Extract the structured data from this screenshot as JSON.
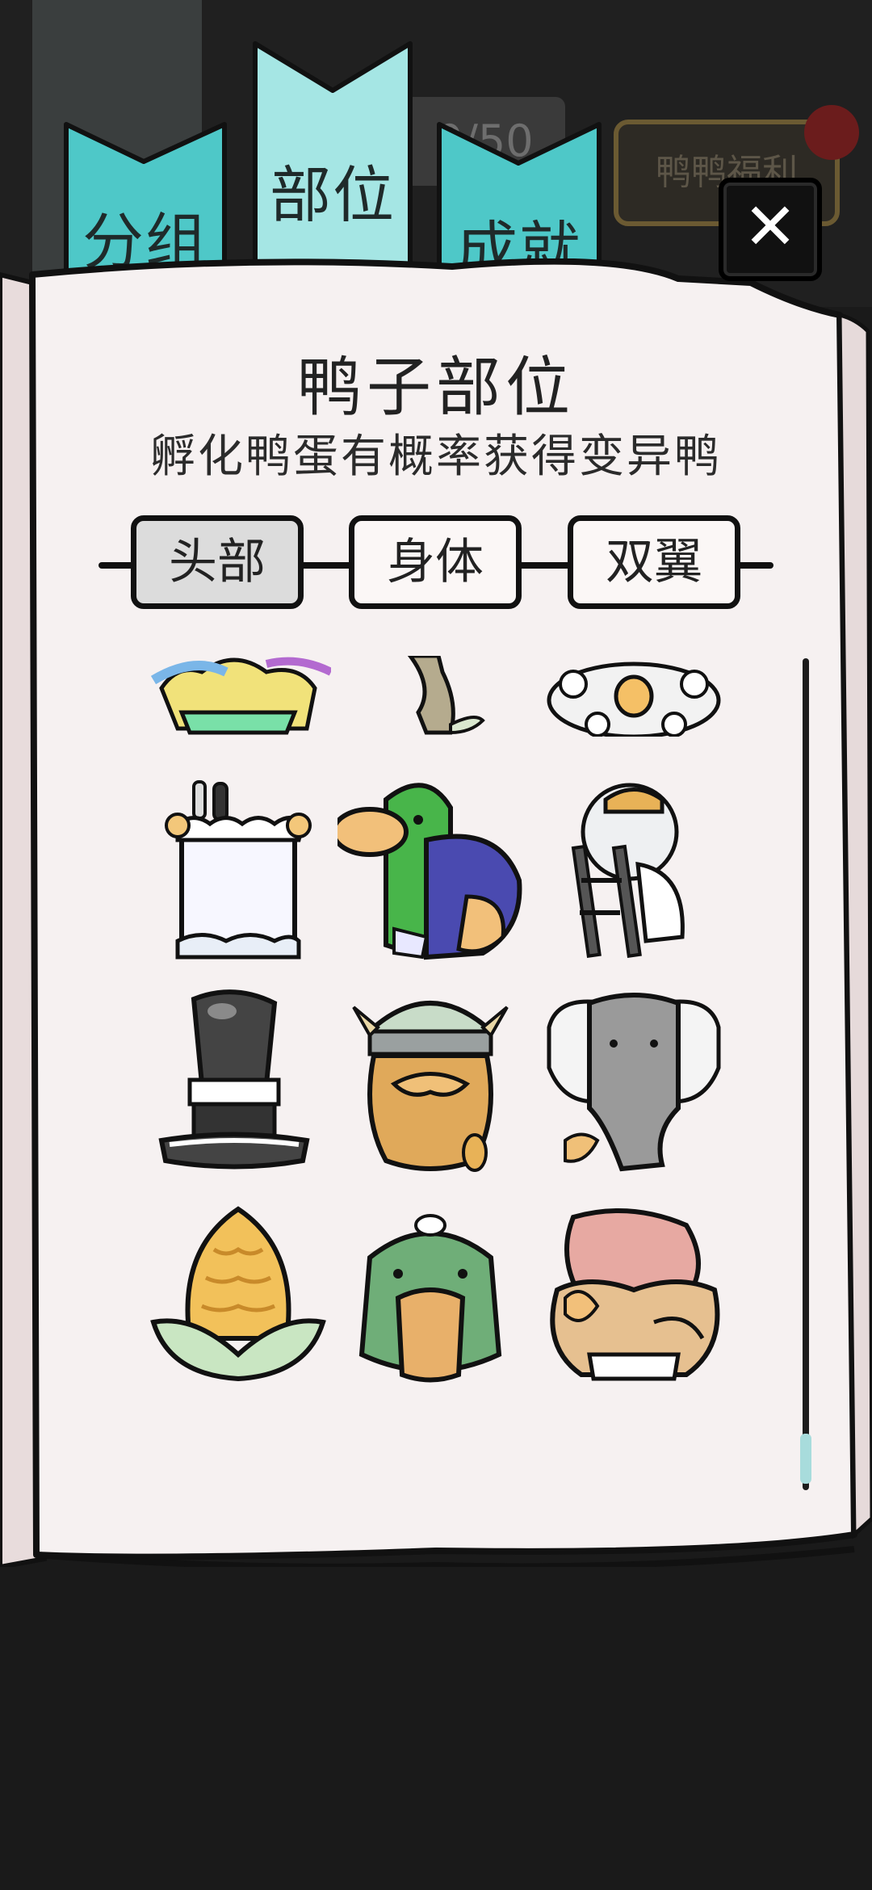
{
  "header": {
    "faded_counter": "0/50",
    "welfare_label": "鸭鸭福利",
    "tabs": [
      {
        "label": "分组",
        "active": false
      },
      {
        "label": "部位",
        "active": true
      },
      {
        "label": "成就",
        "active": false
      }
    ],
    "close_symbol": "✕"
  },
  "panel": {
    "title": "鸭子部位",
    "subtitle": "孵化鸭蛋有概率获得变异鸭"
  },
  "segments": {
    "items": [
      {
        "label": "头部",
        "active": true
      },
      {
        "label": "身体",
        "active": false
      },
      {
        "label": "双翼",
        "active": false
      }
    ]
  },
  "grid": {
    "items": [
      {
        "icon": "rainbow-wig-icon"
      },
      {
        "icon": "tree-branch-icon"
      },
      {
        "icon": "chicken-flock-icon"
      },
      {
        "icon": "birthday-cake-icon"
      },
      {
        "icon": "mallard-duck-icon"
      },
      {
        "icon": "ladder-hardhat-icon"
      },
      {
        "icon": "top-hat-icon"
      },
      {
        "icon": "viking-helmet-icon"
      },
      {
        "icon": "elephant-head-icon"
      },
      {
        "icon": "corn-icon"
      },
      {
        "icon": "crocodile-head-icon"
      },
      {
        "icon": "ear-pile-icon"
      }
    ]
  },
  "colors": {
    "tab_teal": "#4ec8c8",
    "tab_active": "#a5e6e4",
    "paper": "#f6f1f1",
    "scroll_thumb": "#a8dcdc",
    "outline": "#111111"
  },
  "scroll": {
    "position": 0.92
  }
}
